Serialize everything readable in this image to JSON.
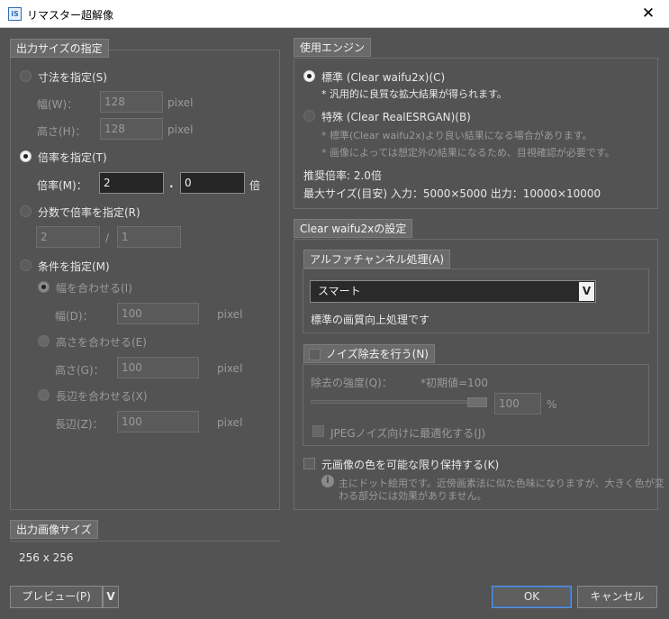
{
  "window": {
    "title": "リマスター超解像",
    "icon_text": "iS",
    "close_glyph": "✕"
  },
  "output_size": {
    "title": "出力サイズの指定",
    "dim_mode": {
      "label": "寸法を指定(S)",
      "width_label": "幅(W)：",
      "width_value": "128",
      "height_label": "高さ(H)：",
      "height_value": "128",
      "unit": "pixel"
    },
    "scale_mode": {
      "label": "倍率を指定(T)",
      "field_label": "倍率(M)：",
      "int_value": "2",
      "dot": ".",
      "frac_value": "0",
      "unit": "倍"
    },
    "fraction_mode": {
      "label": "分数で倍率を指定(R)",
      "numerator": "2",
      "slash": "/",
      "denominator": "1"
    },
    "condition_mode": {
      "label": "条件を指定(M)",
      "fit_width": {
        "label": "幅を合わせる(I)",
        "field_label": "幅(D)：",
        "value": "100",
        "unit": "pixel"
      },
      "fit_height": {
        "label": "高さを合わせる(E)",
        "field_label": "高さ(G)：",
        "value": "100",
        "unit": "pixel"
      },
      "fit_long": {
        "label": "長辺を合わせる(X)",
        "field_label": "長辺(Z)：",
        "value": "100",
        "unit": "pixel"
      }
    }
  },
  "output_image": {
    "title": "出力画像サイズ",
    "value": "256 x 256"
  },
  "engine": {
    "title": "使用エンジン",
    "standard": {
      "label": "標準 (Clear waifu2x)(C)",
      "note": "* 汎用的に良質な拡大結果が得られます。"
    },
    "special": {
      "label": "特殊 (Clear RealESRGAN)(B)",
      "note1": "* 標準(Clear waifu2x)より良い結果になる場合があります。",
      "note2": "* 画像によっては想定外の結果になるため、目視確認が必要です。"
    },
    "recommended": "推奨倍率: 2.0倍",
    "max_size": "最大サイズ(目安) 入力：5000×5000 出力：10000×10000"
  },
  "waifu_settings": {
    "title": "Clear waifu2xの設定",
    "alpha": {
      "title": "アルファチャンネル処理(A)",
      "selected": "スマート",
      "arrow": "V",
      "desc": "標準の画質向上処理です"
    },
    "noise": {
      "title": "ノイズ除去を行う(N)",
      "strength_label": "除去の強度(Q)：",
      "default_note": "*初期値=100",
      "value": "100",
      "unit": "%",
      "slider_level": 1.0,
      "jpeg_label": "JPEGノイズ向けに最適化する(J)"
    },
    "keep_color": {
      "label": "元画像の色を可能な限り保持する(K)",
      "info_icon": "i",
      "note_line1": "主にドット絵用です。近傍画素法に似た色味になりますが、大きく色が変",
      "note_line2": "わる部分には効果がありません。"
    }
  },
  "buttons": {
    "preview": "プレビュー(P)",
    "preview_arrow": "V",
    "ok": "OK",
    "cancel": "キャンセル"
  }
}
